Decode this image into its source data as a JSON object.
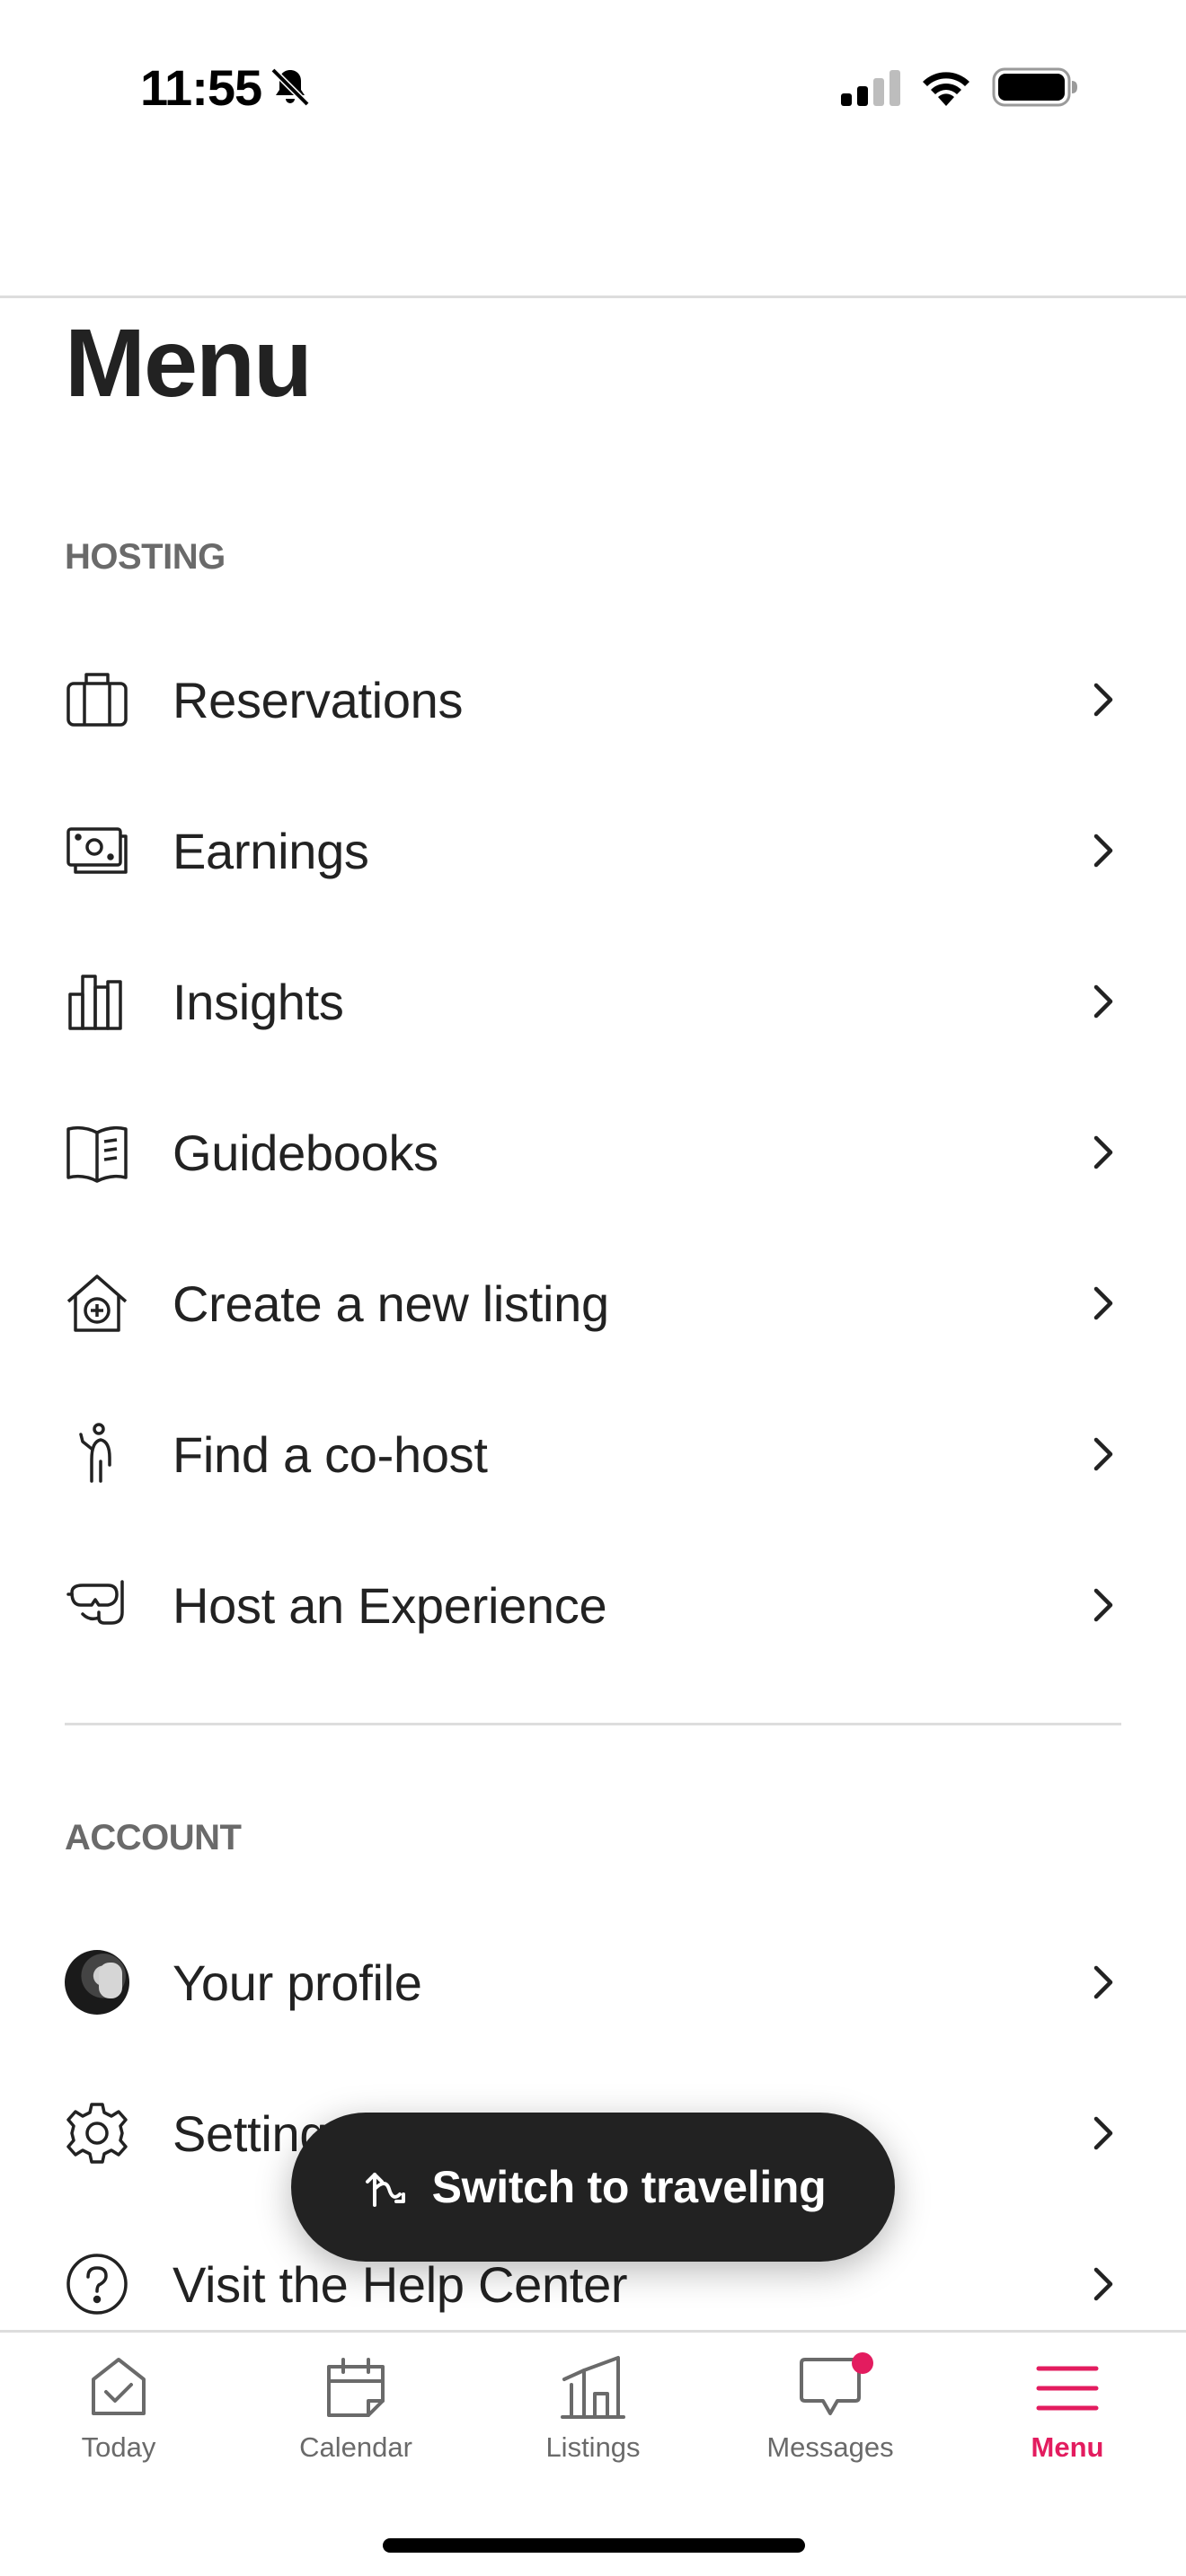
{
  "status_bar": {
    "time": "11:55",
    "icons": [
      "bell-slash-icon",
      "cellular-signal-icon",
      "wifi-icon",
      "battery-icon"
    ]
  },
  "page": {
    "title": "Menu"
  },
  "hosting": {
    "label": "HOSTING",
    "items": [
      {
        "label": "Reservations",
        "icon": "suitcase-icon"
      },
      {
        "label": "Earnings",
        "icon": "cash-icon"
      },
      {
        "label": "Insights",
        "icon": "bar-chart-icon"
      },
      {
        "label": "Guidebooks",
        "icon": "book-icon"
      },
      {
        "label": "Create a new listing",
        "icon": "house-plus-icon"
      },
      {
        "label": "Find a co-host",
        "icon": "person-icon"
      },
      {
        "label": "Host an Experience",
        "icon": "snorkel-mask-icon"
      }
    ]
  },
  "account": {
    "label": "ACCOUNT",
    "items": [
      {
        "label": "Your profile",
        "icon": "avatar"
      },
      {
        "label": "Settings",
        "icon": "gear-icon"
      },
      {
        "label": "Visit the Help Center",
        "icon": "help-circle-icon"
      }
    ]
  },
  "switch_button": {
    "label": "Switch to traveling",
    "icon": "switch-arrows-icon"
  },
  "tab_bar": {
    "tabs": [
      {
        "label": "Today",
        "icon": "check-square-icon",
        "active": false
      },
      {
        "label": "Calendar",
        "icon": "calendar-icon",
        "active": false
      },
      {
        "label": "Listings",
        "icon": "building-icon",
        "active": false
      },
      {
        "label": "Messages",
        "icon": "chat-bubble-icon",
        "active": false,
        "badge": true
      },
      {
        "label": "Menu",
        "icon": "hamburger-icon",
        "active": true
      }
    ]
  },
  "colors": {
    "accent": "#e31c5f",
    "text": "#222222",
    "muted": "#6a6a6a",
    "divider": "#dddddd",
    "pill": "#222222"
  }
}
